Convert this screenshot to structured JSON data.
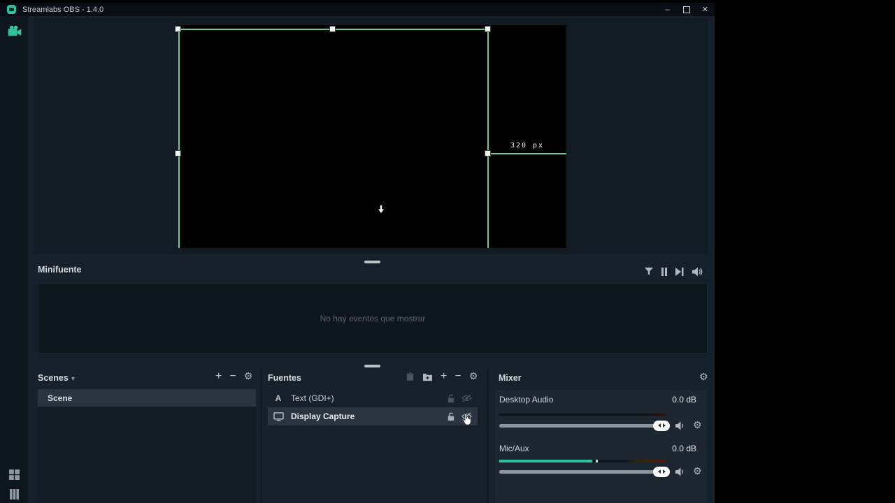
{
  "titlebar": {
    "title": "Streamlabs OBS - 1.4.0"
  },
  "window_controls": {
    "minimize": "–",
    "close": "✕"
  },
  "icons": {
    "add": "+",
    "remove": "−",
    "gear": "⚙",
    "chevron_down": "▾"
  },
  "preview": {
    "selection_width_label": "320 px"
  },
  "minifeed": {
    "title": "Minifuente",
    "empty_message": "No hay eventos que mostrar"
  },
  "scenes": {
    "title": "Scenes",
    "items": [
      {
        "name": "Scene"
      }
    ]
  },
  "sources": {
    "title": "Fuentes",
    "text_source_glyph": "A",
    "items": [
      {
        "name": "Text (GDI+)"
      },
      {
        "name": "Display Capture"
      }
    ]
  },
  "mixer": {
    "title": "Mixer",
    "channels": [
      {
        "name": "Desktop Audio",
        "level": "0.0 dB"
      },
      {
        "name": "Mic/Aux",
        "level": "0.0 dB"
      }
    ]
  },
  "colors": {
    "accent": "#2fc0a0",
    "selection_green": "#72c795",
    "meter_teal": "#2fbf9a"
  }
}
